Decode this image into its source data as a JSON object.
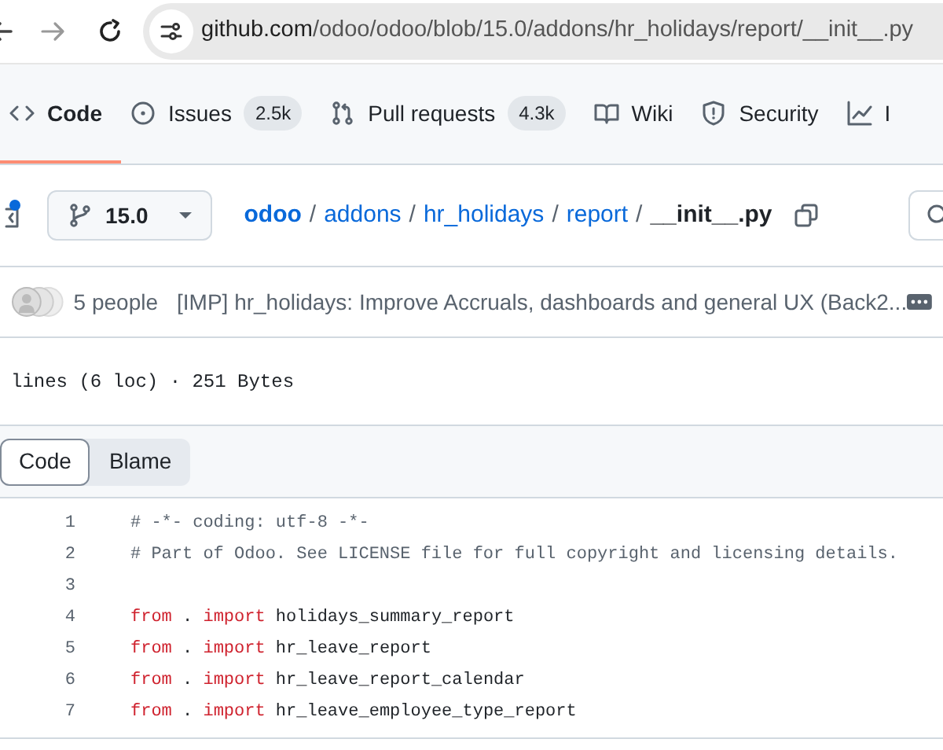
{
  "browser": {
    "url_host": "github.com",
    "url_path": "/odoo/odoo/blob/15.0/addons/hr_holidays/report/__init__.py"
  },
  "repo_tabs": [
    {
      "label": "Code",
      "selected": true
    },
    {
      "label": "Issues",
      "count": "2.5k",
      "selected": false
    },
    {
      "label": "Pull requests",
      "count": "4.3k",
      "selected": false
    },
    {
      "label": "Wiki",
      "selected": false
    },
    {
      "label": "Security",
      "selected": false
    },
    {
      "label": "I",
      "selected": false
    }
  ],
  "branch": {
    "label": "15.0",
    "unread": true
  },
  "breadcrumbs": [
    {
      "label": "odoo",
      "kind": "repo"
    },
    {
      "label": "/",
      "kind": "separator"
    },
    {
      "label": "addons",
      "kind": "dir"
    },
    {
      "label": "/",
      "kind": "separator"
    },
    {
      "label": "hr_holidays",
      "kind": "dir"
    },
    {
      "label": "/",
      "kind": "separator"
    },
    {
      "label": "report",
      "kind": "dir"
    },
    {
      "label": "/",
      "kind": "separator"
    },
    {
      "label": "__init__.py",
      "kind": "file"
    }
  ],
  "commit": {
    "contributors": "5 people",
    "message": "[IMP] hr_holidays: Improve Accruals, dashboards and general UX (Back2..."
  },
  "file_info": "lines (6 loc) · 251 Bytes",
  "view_tabs": [
    {
      "label": "Code",
      "selected": true
    },
    {
      "label": "Blame",
      "selected": false
    }
  ],
  "code_lines": [
    {
      "number": "1",
      "tokens": [
        {
          "kind": "comment",
          "text": "# -*- coding: utf-8 -*-"
        }
      ]
    },
    {
      "number": "2",
      "tokens": [
        {
          "kind": "comment",
          "text": "# Part of Odoo. See LICENSE file for full copyright and licensing details."
        }
      ]
    },
    {
      "number": "3"
    },
    {
      "number": "4",
      "tokens": [
        {
          "kind": "keyword",
          "text": "from"
        },
        {
          "kind": "plain",
          "text": " . "
        },
        {
          "kind": "keyword",
          "text": "import"
        },
        {
          "kind": "plain",
          "text": " holidays_summary_report"
        }
      ]
    },
    {
      "number": "5",
      "tokens": [
        {
          "kind": "keyword",
          "text": "from"
        },
        {
          "kind": "plain",
          "text": " . "
        },
        {
          "kind": "keyword",
          "text": "import"
        },
        {
          "kind": "plain",
          "text": " hr_leave_report"
        }
      ]
    },
    {
      "number": "6",
      "tokens": [
        {
          "kind": "keyword",
          "text": "from"
        },
        {
          "kind": "plain",
          "text": " . "
        },
        {
          "kind": "keyword",
          "text": "import"
        },
        {
          "kind": "plain",
          "text": " hr_leave_report_calendar"
        }
      ]
    },
    {
      "number": "7",
      "tokens": [
        {
          "kind": "keyword",
          "text": "from"
        },
        {
          "kind": "plain",
          "text": " . "
        },
        {
          "kind": "keyword",
          "text": "import"
        },
        {
          "kind": "plain",
          "text": " hr_leave_employee_type_report"
        }
      ]
    }
  ]
}
